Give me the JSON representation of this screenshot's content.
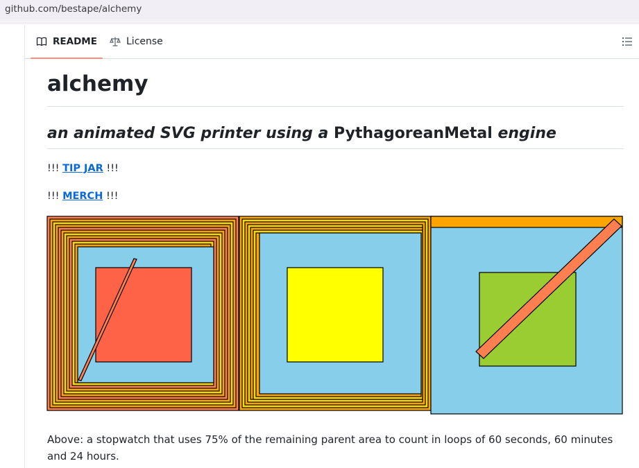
{
  "browser": {
    "url": "github.com/bestape/alchemy"
  },
  "tabs": {
    "readme": "README",
    "license": "License"
  },
  "readme": {
    "title": "alchemy",
    "subtitle": {
      "part1": "an animated SVG printer using a ",
      "part2": "PythagoreanMetal",
      "part3": " engine"
    },
    "tip_line": {
      "prefix": "!!! ",
      "link": "TIP JAR",
      "suffix": " !!!"
    },
    "merch_line": {
      "prefix": "!!! ",
      "link": "MERCH",
      "suffix": " !!!"
    },
    "caption": "Above: a stopwatch that uses 75% of the remaining parent area to count in loops of 60 seconds, 60 minutes and 24 hours."
  },
  "icons": {
    "readme": "book-icon",
    "license": "law-scale-icon",
    "outline": "list-unordered-icon"
  },
  "colors": {
    "frame_orange": "#ffa500",
    "frame_coral": "#ff7f50",
    "frame_gold": "#ffd700",
    "sky": "#87ceeb",
    "tomato": "#ff6347",
    "yellow": "#ffff00",
    "green": "#9acd32"
  }
}
